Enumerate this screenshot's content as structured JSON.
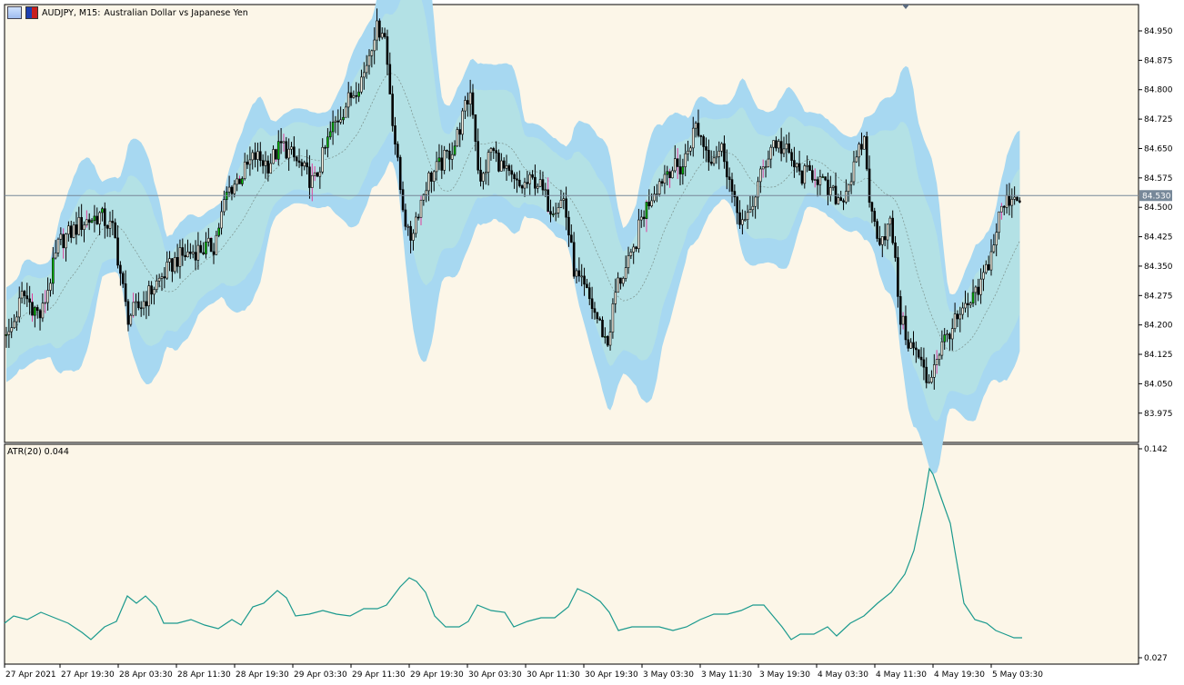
{
  "header": {
    "symbol": "AUDJPY, M15:",
    "description": "Australian Dollar vs Japanese Yen"
  },
  "colors": {
    "background": "#fcf6e8",
    "outer_band": "#a7d8f1",
    "inner_band": "#b3e1e5",
    "candle": "#000000",
    "candle_bull_accent": "#00c000",
    "wick_accent": "#e0409a",
    "atr_line": "#1b9a8e",
    "bid_line": "#778899",
    "ma_line": "#7a8f8a"
  },
  "atr_label": "ATR(20) 0.044",
  "chart_data": [
    {
      "type": "candlestick",
      "title": "AUDJPY, M15:  Australian Dollar vs Japanese Yen",
      "ylim": [
        83.9,
        85.0
      ],
      "y_ticks": [
        "84.950",
        "84.875",
        "84.800",
        "84.725",
        "84.650",
        "84.575",
        "84.500",
        "84.425",
        "84.350",
        "84.275",
        "84.200",
        "84.125",
        "84.050",
        "83.975"
      ],
      "current_price": "84.530",
      "x_ticks": [
        "27 Apr 2021",
        "27 Apr 19:30",
        "28 Apr 03:30",
        "28 Apr 11:30",
        "28 Apr 19:30",
        "29 Apr 03:30",
        "29 Apr 11:30",
        "29 Apr 19:30",
        "30 Apr 03:30",
        "30 Apr 11:30",
        "30 Apr 19:30",
        "3 May 03:30",
        "3 May 11:30",
        "3 May 19:30",
        "4 May 03:30",
        "4 May 11:30",
        "4 May 19:30",
        "5 May 03:30"
      ],
      "price_path": [
        [
          0,
          84.24
        ],
        [
          10,
          84.17
        ],
        [
          25,
          84.28
        ],
        [
          45,
          84.22
        ],
        [
          65,
          84.41
        ],
        [
          90,
          84.46
        ],
        [
          110,
          84.48
        ],
        [
          125,
          84.44
        ],
        [
          140,
          84.22
        ],
        [
          155,
          84.25
        ],
        [
          170,
          84.3
        ],
        [
          195,
          84.37
        ],
        [
          215,
          84.39
        ],
        [
          235,
          84.4
        ],
        [
          250,
          84.54
        ],
        [
          265,
          84.58
        ],
        [
          280,
          84.63
        ],
        [
          295,
          84.61
        ],
        [
          310,
          84.66
        ],
        [
          325,
          84.62
        ],
        [
          345,
          84.56
        ],
        [
          365,
          84.7
        ],
        [
          385,
          84.78
        ],
        [
          400,
          84.84
        ],
        [
          412,
          84.95
        ],
        [
          422,
          84.96
        ],
        [
          432,
          84.72
        ],
        [
          440,
          84.55
        ],
        [
          450,
          84.41
        ],
        [
          458,
          84.48
        ],
        [
          470,
          84.57
        ],
        [
          485,
          84.61
        ],
        [
          500,
          84.66
        ],
        [
          510,
          84.74
        ],
        [
          518,
          84.8
        ],
        [
          528,
          84.55
        ],
        [
          540,
          84.65
        ],
        [
          555,
          84.59
        ],
        [
          570,
          84.55
        ],
        [
          590,
          84.57
        ],
        [
          605,
          84.5
        ],
        [
          620,
          84.52
        ],
        [
          632,
          84.33
        ],
        [
          645,
          84.28
        ],
        [
          658,
          84.21
        ],
        [
          668,
          84.15
        ],
        [
          678,
          84.3
        ],
        [
          695,
          84.37
        ],
        [
          705,
          84.47
        ],
        [
          718,
          84.54
        ],
        [
          735,
          84.6
        ],
        [
          750,
          84.6
        ],
        [
          765,
          84.71
        ],
        [
          780,
          84.63
        ],
        [
          795,
          84.65
        ],
        [
          808,
          84.5
        ],
        [
          820,
          84.45
        ],
        [
          835,
          84.57
        ],
        [
          850,
          84.67
        ],
        [
          865,
          84.64
        ],
        [
          880,
          84.58
        ],
        [
          895,
          84.59
        ],
        [
          910,
          84.54
        ],
        [
          925,
          84.52
        ],
        [
          940,
          84.6
        ],
        [
          950,
          84.68
        ],
        [
          958,
          84.48
        ],
        [
          968,
          84.42
        ],
        [
          980,
          84.46
        ],
        [
          990,
          84.22
        ],
        [
          1000,
          84.15
        ],
        [
          1010,
          84.12
        ],
        [
          1020,
          84.05
        ],
        [
          1030,
          84.12
        ],
        [
          1045,
          84.19
        ],
        [
          1060,
          84.23
        ],
        [
          1075,
          84.28
        ],
        [
          1090,
          84.38
        ],
        [
          1100,
          84.49
        ],
        [
          1112,
          84.53
        ],
        [
          1124,
          84.53
        ]
      ]
    },
    {
      "type": "line",
      "title": "ATR(20) 0.044",
      "ylim": [
        0.027,
        0.142
      ],
      "y_ticks": [
        "0.142",
        "0.027"
      ],
      "series": [
        {
          "values": [
            [
              5,
              0.046
            ],
            [
              15,
              0.05
            ],
            [
              30,
              0.048
            ],
            [
              45,
              0.052
            ],
            [
              60,
              0.049
            ],
            [
              75,
              0.046
            ],
            [
              90,
              0.041
            ],
            [
              100,
              0.037
            ],
            [
              115,
              0.044
            ],
            [
              128,
              0.047
            ],
            [
              140,
              0.061
            ],
            [
              150,
              0.057
            ],
            [
              160,
              0.061
            ],
            [
              172,
              0.055
            ],
            [
              180,
              0.046
            ],
            [
              195,
              0.046
            ],
            [
              210,
              0.048
            ],
            [
              225,
              0.045
            ],
            [
              240,
              0.043
            ],
            [
              255,
              0.048
            ],
            [
              265,
              0.045
            ],
            [
              278,
              0.055
            ],
            [
              290,
              0.057
            ],
            [
              305,
              0.064
            ],
            [
              315,
              0.06
            ],
            [
              325,
              0.05
            ],
            [
              340,
              0.051
            ],
            [
              355,
              0.053
            ],
            [
              370,
              0.051
            ],
            [
              385,
              0.05
            ],
            [
              400,
              0.054
            ],
            [
              415,
              0.054
            ],
            [
              425,
              0.056
            ],
            [
              440,
              0.066
            ],
            [
              450,
              0.071
            ],
            [
              458,
              0.069
            ],
            [
              468,
              0.063
            ],
            [
              478,
              0.05
            ],
            [
              490,
              0.044
            ],
            [
              505,
              0.044
            ],
            [
              515,
              0.047
            ],
            [
              525,
              0.056
            ],
            [
              540,
              0.053
            ],
            [
              555,
              0.052
            ],
            [
              565,
              0.044
            ],
            [
              580,
              0.047
            ],
            [
              595,
              0.049
            ],
            [
              610,
              0.049
            ],
            [
              625,
              0.055
            ],
            [
              635,
              0.065
            ],
            [
              648,
              0.062
            ],
            [
              660,
              0.058
            ],
            [
              670,
              0.052
            ],
            [
              680,
              0.042
            ],
            [
              695,
              0.044
            ],
            [
              710,
              0.044
            ],
            [
              725,
              0.044
            ],
            [
              740,
              0.042
            ],
            [
              755,
              0.044
            ],
            [
              770,
              0.048
            ],
            [
              785,
              0.051
            ],
            [
              800,
              0.051
            ],
            [
              815,
              0.053
            ],
            [
              828,
              0.056
            ],
            [
              840,
              0.056
            ],
            [
              850,
              0.05
            ],
            [
              860,
              0.044
            ],
            [
              870,
              0.037
            ],
            [
              880,
              0.04
            ],
            [
              895,
              0.04
            ],
            [
              910,
              0.044
            ],
            [
              920,
              0.039
            ],
            [
              935,
              0.046
            ],
            [
              950,
              0.05
            ],
            [
              965,
              0.057
            ],
            [
              980,
              0.063
            ],
            [
              995,
              0.073
            ],
            [
              1005,
              0.086
            ],
            [
              1015,
              0.11
            ],
            [
              1022,
              0.131
            ],
            [
              1026,
              0.128
            ],
            [
              1035,
              0.115
            ],
            [
              1045,
              0.101
            ],
            [
              1050,
              0.086
            ],
            [
              1060,
              0.057
            ],
            [
              1072,
              0.048
            ],
            [
              1085,
              0.046
            ],
            [
              1095,
              0.042
            ],
            [
              1105,
              0.04
            ],
            [
              1115,
              0.038
            ],
            [
              1124,
              0.038
            ]
          ]
        }
      ]
    }
  ]
}
